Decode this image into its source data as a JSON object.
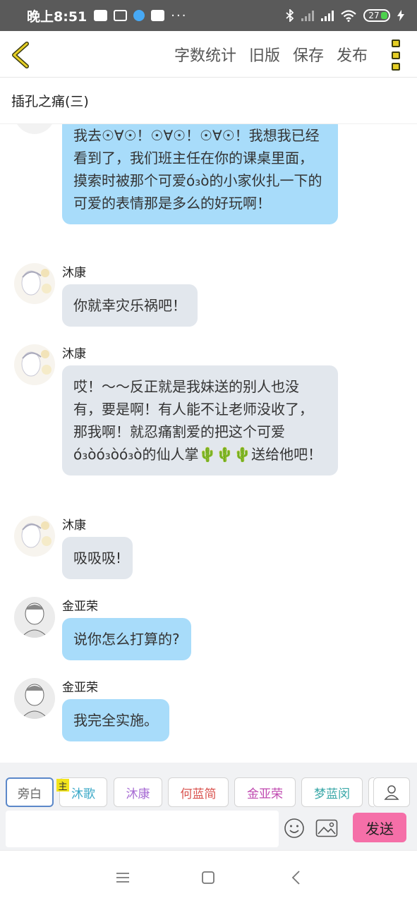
{
  "status_bar": {
    "time": "晚上8:51",
    "dots": "···",
    "battery": "27"
  },
  "header": {
    "actions": [
      "字数统计",
      "旧版",
      "保存",
      "发布"
    ]
  },
  "title": "插孔之痛(三)",
  "messages": [
    {
      "sender": "",
      "text": "我去☉∀☉！☉∀☉！☉∀☉！我想我已经看到了，我们班主任在你的课桌里面，摸索时被那个可爱ό₃ò的小家伙扎一下的可爱的表情那是多么的好玩啊！"
    },
    {
      "sender": "沐康",
      "text": "你就幸灾乐祸吧！"
    },
    {
      "sender": "沐康",
      "text": "哎！～～反正就是我妹送的别人也没有，要是啊！有人能不让老师没收了，那我啊！就忍痛割爱的把这个可爱ό₃òό₃òό₃ò的仙人掌🌵🌵🌵送给他吧！"
    },
    {
      "sender": "沐康",
      "text": "吸吸吸!"
    },
    {
      "sender": "金亚荣",
      "text": "说你怎么打算的?"
    },
    {
      "sender": "金亚荣",
      "text": "我完全实施。"
    }
  ],
  "speakers": [
    {
      "label": "旁白",
      "color": "#666666"
    },
    {
      "label": "沐歌",
      "color": "#3aa8c7"
    },
    {
      "label": "沐康",
      "color": "#a66ad3"
    },
    {
      "label": "何蓝简",
      "color": "#d9534f"
    },
    {
      "label": "金亚荣",
      "color": "#c04ab0"
    },
    {
      "label": "梦蓝闵",
      "color": "#3aa8a8"
    }
  ],
  "host_tag": "主",
  "input": {
    "value": "",
    "send_label": "发送"
  },
  "colors": {
    "bubble_blue": "#a8dcfa",
    "bubble_gray": "#e2e7ed",
    "send": "#f56fa8",
    "accent_yellow": "#e6cf24"
  }
}
